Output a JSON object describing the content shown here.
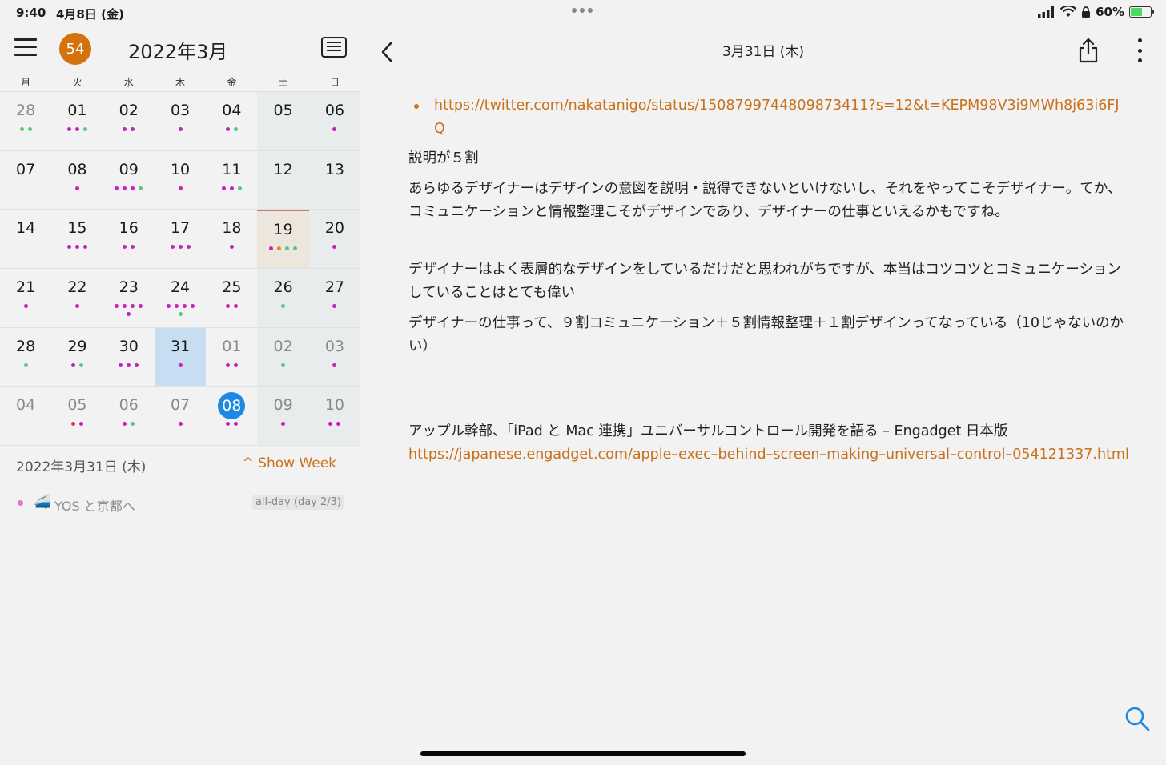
{
  "status": {
    "time": "9:40",
    "date": "4月8日 (金)",
    "battery": "60%",
    "battery_level": 0.6
  },
  "calendar": {
    "badge": "54",
    "title": "2022年3月",
    "weekdays": [
      "月",
      "火",
      "水",
      "木",
      "金",
      "土",
      "日"
    ],
    "colors": {
      "m": "#c81fbf",
      "g": "#5bc77d",
      "o": "#e8862a",
      "r": "#e53935"
    },
    "weeks": [
      [
        {
          "n": "28",
          "other": true,
          "dots": "gg"
        },
        {
          "n": "01",
          "dots": "mmg"
        },
        {
          "n": "02",
          "dots": "mm"
        },
        {
          "n": "03",
          "dots": "m"
        },
        {
          "n": "04",
          "dots": "mg"
        },
        {
          "n": "05",
          "dots": ""
        },
        {
          "n": "06",
          "dots": "m"
        }
      ],
      [
        {
          "n": "07",
          "dots": ""
        },
        {
          "n": "08",
          "dots": "m"
        },
        {
          "n": "09",
          "dots": "mmmg"
        },
        {
          "n": "10",
          "dots": "m"
        },
        {
          "n": "11",
          "dots": "mmg"
        },
        {
          "n": "12",
          "dots": ""
        },
        {
          "n": "13",
          "dots": ""
        }
      ],
      [
        {
          "n": "14",
          "dots": ""
        },
        {
          "n": "15",
          "dots": "mmm"
        },
        {
          "n": "16",
          "dots": "mm"
        },
        {
          "n": "17",
          "dots": "mmm"
        },
        {
          "n": "18",
          "dots": "m"
        },
        {
          "n": "19",
          "dots": "mogg",
          "mark": "highlight"
        },
        {
          "n": "20",
          "dots": "m"
        }
      ],
      [
        {
          "n": "21",
          "dots": "m"
        },
        {
          "n": "22",
          "dots": "m"
        },
        {
          "n": "23",
          "dots": "mmmmm"
        },
        {
          "n": "24",
          "dots": "mmmmg"
        },
        {
          "n": "25",
          "dots": "mm"
        },
        {
          "n": "26",
          "dots": "g"
        },
        {
          "n": "27",
          "dots": "m"
        }
      ],
      [
        {
          "n": "28",
          "dots": "g"
        },
        {
          "n": "29",
          "dots": "mg"
        },
        {
          "n": "30",
          "dots": "mmm"
        },
        {
          "n": "31",
          "dots": "m",
          "mark": "selected"
        },
        {
          "n": "01",
          "other": true,
          "dots": "mm"
        },
        {
          "n": "02",
          "other": true,
          "dots": "g"
        },
        {
          "n": "03",
          "other": true,
          "dots": "m"
        }
      ],
      [
        {
          "n": "04",
          "other": true,
          "dots": ""
        },
        {
          "n": "05",
          "other": true,
          "dots": "rm"
        },
        {
          "n": "06",
          "other": true,
          "dots": "mg"
        },
        {
          "n": "07",
          "other": true,
          "dots": "m"
        },
        {
          "n": "08",
          "other": true,
          "dots": "mm",
          "mark": "today"
        },
        {
          "n": "09",
          "other": true,
          "dots": "m"
        },
        {
          "n": "10",
          "other": true,
          "dots": "mm"
        }
      ]
    ],
    "selected_date": "2022年3月31日 (木)",
    "show_week": "^ Show Week",
    "event": {
      "title": "YOS と京都へ",
      "chip": "all-day (day 2/3)"
    }
  },
  "note": {
    "title": "3月31日 (木)",
    "link1": "https://twitter.com/nakatanigo/status/1508799744809873411?s=12&t=KEPM98V3i9MWh8j63i6FJQ",
    "p1": "説明が５割",
    "p2": "あらゆるデザイナーはデザインの意図を説明・説得できないといけないし、それをやってこそデザイナー。てか、コミュニケーションと情報整理こそがデザインであり、デザイナーの仕事といえるかもですね。",
    "p3": "デザイナーはよく表層的なデザインをしているだけだと思われがちですが、本当はコツコツとコミュニケーションしていることはとても偉い",
    "p4": "デザイナーの仕事って、９割コミュニケーション＋５割情報整理＋１割デザインってなっている（10じゃないのかい）",
    "p5": "アップル幹部、「iPad と Mac 連携」ユニバーサルコントロール開発を語る – Engadget 日本版",
    "link2": "https://japanese.engadget.com/apple–exec–behind–screen–making–universal–control–054121337.html"
  }
}
